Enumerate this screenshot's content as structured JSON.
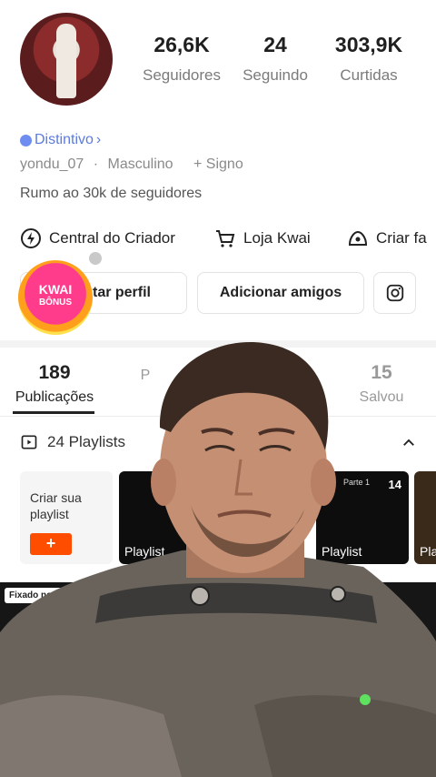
{
  "profile": {
    "stats": [
      {
        "value": "26,6K",
        "label": "Seguidores"
      },
      {
        "value": "24",
        "label": "Seguindo"
      },
      {
        "value": "303,9K",
        "label": "Curtidas"
      }
    ],
    "badge": "Distintivo",
    "username": "yondu_07",
    "gender": "Masculino",
    "sign": "+ Signo",
    "bio": "Rumo ao 30k de seguidores"
  },
  "tools": {
    "creator": "Central do Criador",
    "shop": "Loja Kwai",
    "create_fan": "Criar fa"
  },
  "actions": {
    "edit_profile": "tar perfil",
    "add_friends": "Adicionar amigos"
  },
  "kwai_bonus": {
    "line1": "KWAI",
    "line2": "BÔNUS"
  },
  "tabs": [
    {
      "count": "189",
      "label": "Publicações"
    },
    {
      "count": "",
      "label": "P"
    },
    {
      "count": "15",
      "label": "Salvou"
    }
  ],
  "playlists": {
    "header": "24 Playlists",
    "create_label": "Criar sua playlist",
    "create_plus": "+",
    "cards": [
      {
        "caption": "Playlist",
        "count": "",
        "small": ""
      },
      {
        "caption": "Playlist",
        "count": "14",
        "small": "Parte 1"
      },
      {
        "caption": "Pla",
        "count": "",
        "small": ""
      }
    ]
  },
  "pinned_label": "Fixado no topo",
  "colors": {
    "accent": "#ff4d00",
    "badge": "#5b7be0",
    "kwai_pink": "#ff3c8c"
  }
}
